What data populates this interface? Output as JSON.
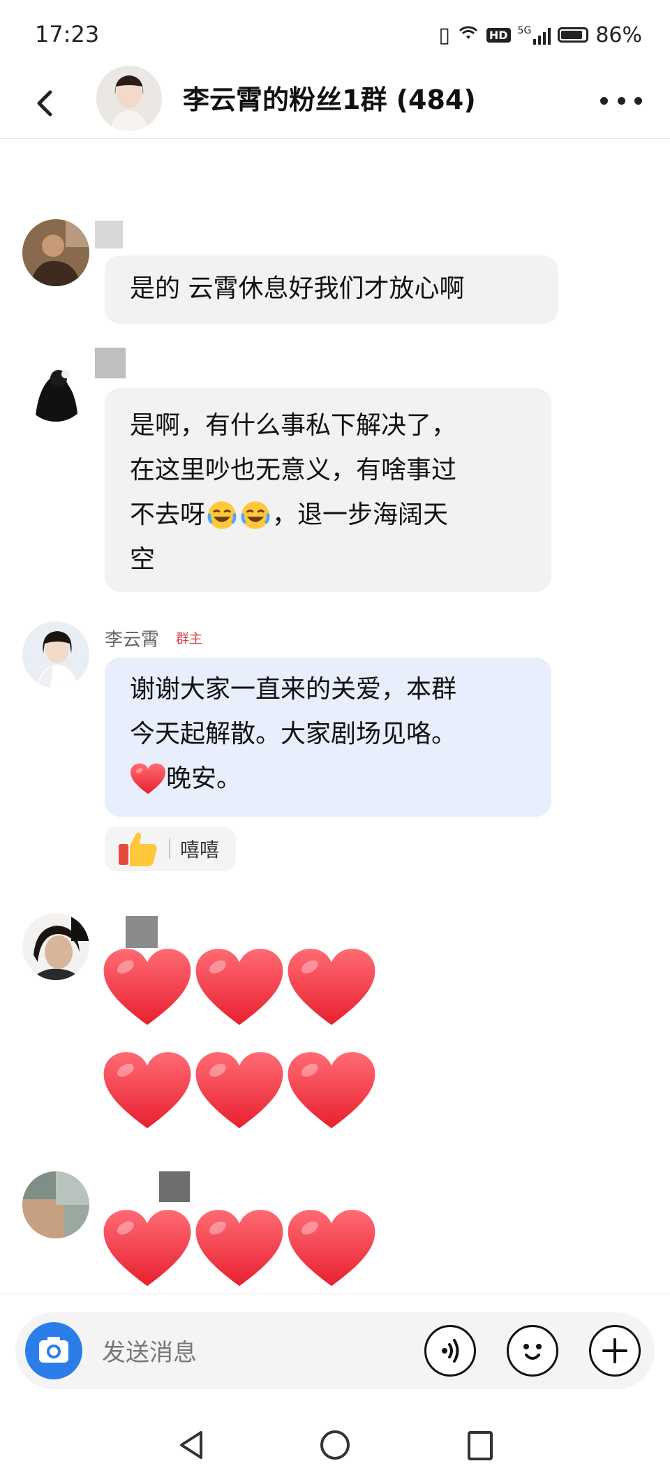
{
  "status_bar": {
    "time": "17:23",
    "hd_badge": "HD",
    "network": "5G",
    "battery": "86%"
  },
  "header": {
    "title": "李云霄的粉丝1群 (484)",
    "back_icon": "back-arrow-icon",
    "more_icon": "more-dots-icon"
  },
  "messages": [
    {
      "text": "是的 云霄休息好我们才放心啊"
    },
    {
      "lines": [
        "是啊，有什么事私下解决了，",
        "在这里吵也无意义，有啥事过",
        "不去呀",
        "，退一步海阔天",
        "空"
      ],
      "emoji": "rolling-laugh-emoji"
    },
    {
      "sender": "李云霄",
      "badge": "群主",
      "lines": [
        "谢谢大家一直来的关爱，本群",
        "今天起解散。大家剧场见咯。",
        "晚安。"
      ],
      "emoji": "red-heart-emoji",
      "reaction": {
        "emoji": "thumbs-up-icon",
        "label": "嘻嘻"
      }
    },
    {
      "hearts_rows": 2,
      "hearts_per_row": 3
    },
    {
      "hearts_rows": 1,
      "hearts_per_row": 3
    }
  ],
  "input": {
    "placeholder": "发送消息",
    "camera_icon": "camera-icon",
    "voice_icon": "voice-icon",
    "emoji_icon": "emoji-icon",
    "plus_icon": "plus-icon"
  },
  "colors": {
    "owner_bubble": "#e8eefc",
    "bubble": "#f2f2f2",
    "camera_button": "#2b7de9",
    "heart": "#f5333f",
    "owner_badge": "#e0404f"
  }
}
